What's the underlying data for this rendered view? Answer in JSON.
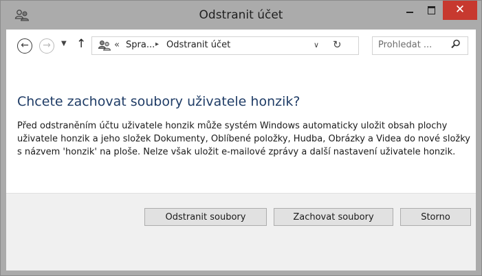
{
  "window": {
    "title": "Odstranit účet",
    "app_icon": "users-icon",
    "controls": {
      "minimize": "minimize-icon",
      "maximize": "maximize-icon",
      "close_label": "✕"
    },
    "colors": {
      "titlebar": "#ababab",
      "close": "#c7392f",
      "heading": "#1f3c66"
    }
  },
  "nav": {
    "back": "back-icon",
    "forward": "forward-icon",
    "recent": "chevron-down-icon",
    "up": "up-arrow-icon"
  },
  "breadcrumb": {
    "overflow": "«",
    "segments": [
      "Spra...",
      "Odstranit účet"
    ],
    "separator": "▸"
  },
  "search": {
    "placeholder": "Prohledat ..."
  },
  "main": {
    "heading": "Chcete zachovat soubory uživatele honzik?",
    "description": "Před odstraněním účtu uživatele honzik může systém Windows automaticky uložit obsah plochy uživatele honzik a jeho složek Dokumenty, Oblíbené položky, Hudba, Obrázky a Videa do nové složky s názvem 'honzik' na ploše. Nelze však uložit e-mailové zprávy a další nastavení uživatele honzik."
  },
  "buttons": {
    "delete_files": "Odstranit soubory",
    "keep_files": "Zachovat soubory",
    "cancel": "Storno"
  }
}
